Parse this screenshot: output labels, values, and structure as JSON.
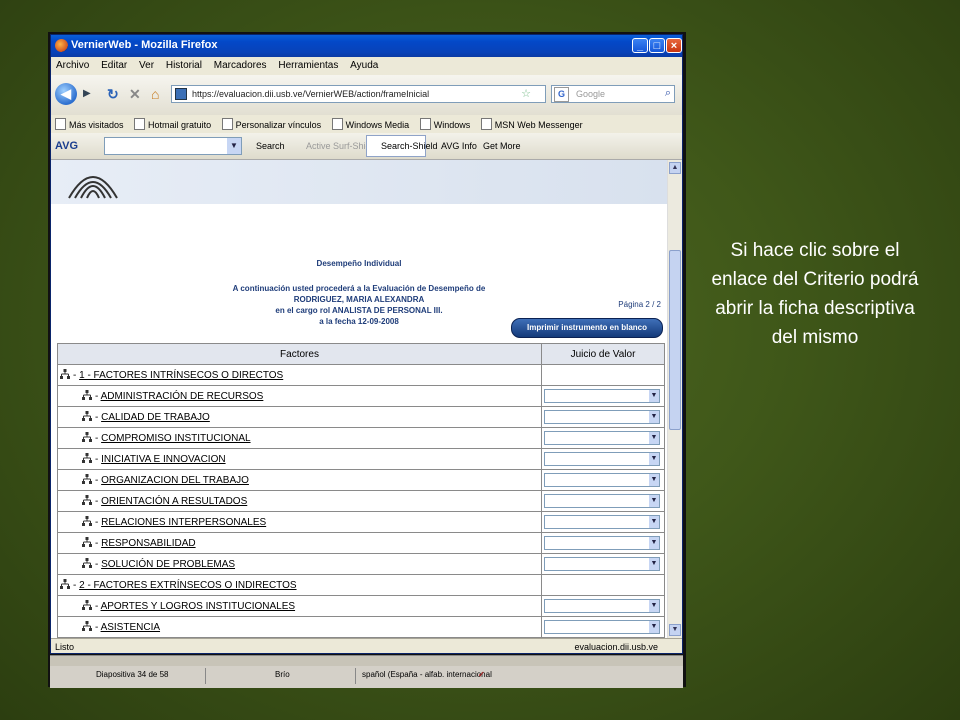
{
  "window": {
    "title": "VernierWeb - Mozilla Firefox"
  },
  "menu": [
    "Archivo",
    "Editar",
    "Ver",
    "Historial",
    "Marcadores",
    "Herramientas",
    "Ayuda"
  ],
  "address": {
    "url": "https://evaluacion.dii.usb.ve/VernierWEB/action/frameInicial",
    "search_placeholder": "Google"
  },
  "bookmarks": [
    "Más visitados",
    "Hotmail gratuito",
    "Personalizar vínculos",
    "Windows Media",
    "Windows",
    "MSN Web Messenger"
  ],
  "toolbar": {
    "avg": "AVG",
    "search": "Search",
    "surf_shield": "Active Surf-Shield",
    "search_shield": "Search-Shield",
    "avg_info": "AVG Info",
    "get_more": "Get More"
  },
  "page": {
    "title": "Desempeño Individual",
    "line1": "A continuación usted procederá a la Evaluación de Desempeño de",
    "line2": "RODRIGUEZ, MARIA ALEXANDRA",
    "line3": "en el cargo rol ANALISTA DE PERSONAL III.",
    "line4": "a la fecha 12-09-2008",
    "pagination": "Página 2 / 2",
    "print_button": "Imprimir instrumento en blanco",
    "col_factores": "Factores",
    "col_juicio": "Juicio de Valor",
    "rows": [
      {
        "label": "1 - FACTORES INTRÍNSECOS O DIRECTOS",
        "level": 0
      },
      {
        "label": "ADMINISTRACIÓN DE RECURSOS",
        "level": 1
      },
      {
        "label": "CALIDAD DE TRABAJO",
        "level": 1
      },
      {
        "label": "COMPROMISO INSTITUCIONAL",
        "level": 1
      },
      {
        "label": "INICIATIVA E INNOVACION",
        "level": 1
      },
      {
        "label": "ORGANIZACION DEL TRABAJO",
        "level": 1
      },
      {
        "label": "ORIENTACIÓN A RESULTADOS",
        "level": 1
      },
      {
        "label": "RELACIONES INTERPERSONALES",
        "level": 1
      },
      {
        "label": "RESPONSABILIDAD",
        "level": 1
      },
      {
        "label": "SOLUCIÓN DE PROBLEMAS",
        "level": 1
      },
      {
        "label": "2 - FACTORES EXTRÍNSECOS O INDIRECTOS",
        "level": 0
      },
      {
        "label": "APORTES Y LOGROS INSTITUCIONALES",
        "level": 1
      },
      {
        "label": "ASISTENCIA",
        "level": 1
      }
    ]
  },
  "status": {
    "left": "Listo",
    "right": "evaluacion.dii.usb.ve"
  },
  "powerpoint": {
    "slide": "Diapositiva 34 de 58",
    "theme": "Brío",
    "language": "spañol (España - alfab. internacional"
  },
  "annotation": "Si hace clic sobre el enlace del Criterio podrá abrir la ficha descriptiva del mismo"
}
